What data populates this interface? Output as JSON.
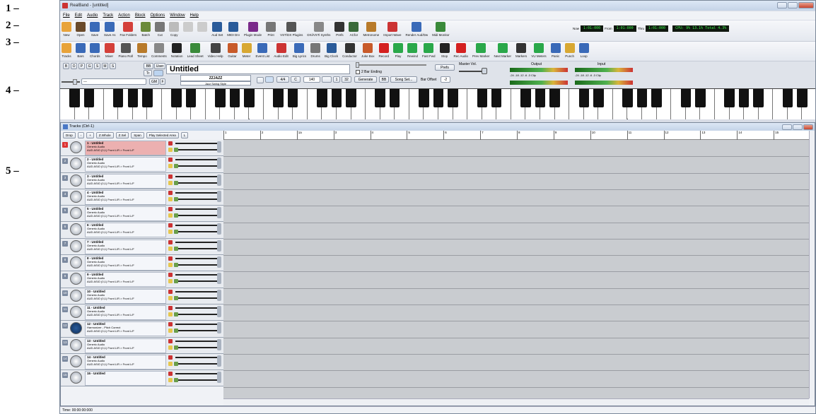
{
  "callouts": [
    "1 –",
    "2 –",
    "3 –",
    "4 –",
    "5 –"
  ],
  "window": {
    "title": "RealBand - [untitled]"
  },
  "menu": [
    "File",
    "Edit",
    "Audio",
    "Track",
    "Action",
    "Block",
    "Options",
    "Window",
    "Help"
  ],
  "toolbar1": {
    "buttons": [
      {
        "label": "New",
        "icon": "new-file-icon",
        "color": "#e8a33a"
      },
      {
        "label": "Open",
        "icon": "open-folder-icon",
        "color": "#6a4a2a"
      },
      {
        "label": "Save",
        "icon": "save-icon",
        "color": "#3a6ab8"
      },
      {
        "label": "Save As",
        "icon": "save-as-icon",
        "color": "#3a6ab8"
      },
      {
        "label": "Fav Folders",
        "icon": "fav-folders-icon",
        "color": "#d4403a"
      },
      {
        "label": "Batch",
        "icon": "batch-icon",
        "color": "#6a8a3a"
      },
      {
        "label": "Cut",
        "icon": "scissors-icon",
        "color": "#777"
      },
      {
        "label": "Copy",
        "icon": "copy-icon",
        "color": "#bbb"
      },
      {
        "label": "",
        "icon": "paste-icon",
        "color": "#ccc"
      },
      {
        "label": "",
        "icon": "undo-icon",
        "color": "#ccc"
      },
      {
        "label": "Aud Set",
        "icon": "audio-settings-icon",
        "color": "#2a5b9a"
      },
      {
        "label": "MIDI Drv",
        "icon": "midi-driver-icon",
        "color": "#2a5b9a"
      },
      {
        "label": "Plugin Mode",
        "icon": "plugin-mode-icon",
        "color": "#7a2a8a"
      },
      {
        "label": "Print",
        "icon": "print-icon",
        "color": "#777"
      },
      {
        "label": "VST/DX Plugins",
        "icon": "plugins-icon",
        "color": "#555"
      },
      {
        "label": "DXi/VSTi Synths",
        "icon": "synths-icon",
        "color": "#888"
      },
      {
        "label": "Prefs",
        "icon": "prefs-icon",
        "color": "#333"
      },
      {
        "label": "ACfor",
        "icon": "acfor-icon",
        "color": "#3a6a3a"
      },
      {
        "label": "Metronome",
        "icon": "metronome-icon",
        "color": "#b87a2a"
      },
      {
        "label": "Import Wave",
        "icon": "import-wave-icon",
        "color": "#c33"
      },
      {
        "label": "Render Aud/Dw",
        "icon": "render-audio-icon",
        "color": "#3a6ab8"
      },
      {
        "label": "Midi Monitor",
        "icon": "midi-monitor-icon",
        "color": "#3a8a3a"
      }
    ],
    "now_label": "Now",
    "now_value": "1:01:000",
    "from_label": "From",
    "from_value": "1:01:000",
    "thru_label": "Thru",
    "thru_value": "1:01:000",
    "cpu": "CPU: 9% 13.1% Total 4.3%"
  },
  "toolbar2": {
    "buttons": [
      {
        "label": "Tracks",
        "icon": "tracks-icon",
        "color": "#e8a33a"
      },
      {
        "label": "Bars",
        "icon": "bars-icon",
        "color": "#3a6ab8"
      },
      {
        "label": "Chords",
        "icon": "chords-icon",
        "color": "#3a6ab8"
      },
      {
        "label": "Mixer",
        "icon": "mixer-icon",
        "color": "#d4403a"
      },
      {
        "label": "Piano Roll",
        "icon": "piano-roll-icon",
        "color": "#555"
      },
      {
        "label": "Tempo",
        "icon": "tempo-icon",
        "color": "#b87a2a"
      },
      {
        "label": "Comments",
        "icon": "comments-icon",
        "color": "#888"
      },
      {
        "label": "Notation",
        "icon": "notation-icon",
        "color": "#222"
      },
      {
        "label": "Lead Sheet",
        "icon": "lead-sheet-icon",
        "color": "#3a8a3a"
      },
      {
        "label": "Video Help",
        "icon": "video-help-icon",
        "color": "#444"
      },
      {
        "label": "Guitar",
        "icon": "guitar-icon",
        "color": "#c85a2a"
      },
      {
        "label": "Meter",
        "icon": "meter-icon",
        "color": "#d8a832"
      },
      {
        "label": "Event List",
        "icon": "event-list-icon",
        "color": "#3a6ab8"
      },
      {
        "label": "Audio Edit",
        "icon": "audio-edit-icon",
        "color": "#c33"
      },
      {
        "label": "Big Lyrics",
        "icon": "big-lyrics-icon",
        "color": "#3a6ab8"
      },
      {
        "label": "Drums",
        "icon": "drums-icon",
        "color": "#777"
      },
      {
        "label": "Big Clock",
        "icon": "big-clock-icon",
        "color": "#2a5b9a"
      },
      {
        "label": "Conductor",
        "icon": "conductor-icon",
        "color": "#333"
      },
      {
        "label": "Juke Box",
        "icon": "juke-box-icon",
        "color": "#c85a2a"
      },
      {
        "label": "Record",
        "icon": "record-icon",
        "color": "#d42020"
      },
      {
        "label": "Play",
        "icon": "play-icon",
        "color": "#2aa84a"
      },
      {
        "label": "Rewind",
        "icon": "rewind-icon",
        "color": "#2aa84a"
      },
      {
        "label": "Fast Fwd",
        "icon": "fast-forward-icon",
        "color": "#2aa84a"
      },
      {
        "label": "Stop",
        "icon": "stop-icon",
        "color": "#222"
      },
      {
        "label": "Rec Audio",
        "icon": "rec-audio-icon",
        "color": "#d42020"
      },
      {
        "label": "Prev Marker",
        "icon": "prev-marker-icon",
        "color": "#2aa84a"
      },
      {
        "label": "Next Marker",
        "icon": "next-marker-icon",
        "color": "#2aa84a"
      },
      {
        "label": "Markers",
        "icon": "markers-icon",
        "color": "#333"
      },
      {
        "label": "VU Meters",
        "icon": "vu-meters-icon",
        "color": "#2aa84a"
      },
      {
        "label": "Panic",
        "icon": "panic-icon",
        "color": "#3a6ab8"
      },
      {
        "label": "Punch",
        "icon": "punch-icon",
        "color": "#d8a832"
      },
      {
        "label": "Loop",
        "icon": "loop-icon",
        "color": "#3a6ab8"
      }
    ]
  },
  "controls": {
    "mode_buttons": [
      "B",
      "O",
      "P",
      "G",
      "S",
      "M",
      "S"
    ],
    "bb_label": "BB",
    "user_label": "User",
    "tr_label": "Tr",
    "gm_label": "GM",
    "f_label": "F",
    "instrument_value": "---",
    "song_title": "Untitled",
    "style_code": "ZZJAZZ",
    "style_name": "Jazz Swing Style",
    "time_sig": "4/4",
    "key": "C",
    "tempo": "140",
    "start_bar": "1",
    "end_bar": "32",
    "generate_label": "Generate",
    "bb2_label": "BB",
    "song_set_label": "Song Set...",
    "bar_offset_label": "Bar Offset",
    "bar_offset_value": "-2",
    "two_bar_ending_label": "2 Bar Ending",
    "prefs_label": "Prefs",
    "master_vol_label": "Master Vol.",
    "output_label": "Output",
    "input_label": "Input",
    "meter_scale": "-24  -18  -12   -6  -3  Clip"
  },
  "tracks_window": {
    "title": "Tracks (Ctrl-1)",
    "toolbar": [
      "Drop",
      "-",
      "+",
      "Z.Whole",
      "Z.Sel",
      "Span",
      "Play Selected Area",
      "L"
    ],
    "ruler": [
      "1",
      "2",
      "1a",
      "3",
      "4",
      "5",
      "6",
      "7",
      "8",
      "9",
      "10",
      "11",
      "12",
      "13",
      "14",
      "15"
    ],
    "tracks": [
      {
        "num": "1",
        "name": "1 - Untitled",
        "type": "Generic Audio",
        "route": "AUD ASIO (0,1) Front L/R > Front L/F",
        "selected": true,
        "hp": false
      },
      {
        "num": "2",
        "name": "2 - Untitled",
        "type": "Generic Audio",
        "route": "AUD ASIO (0,1) Front L/R > Front L/F",
        "selected": false,
        "hp": false
      },
      {
        "num": "3",
        "name": "3 - Untitled",
        "type": "Generic Audio",
        "route": "AUD ASIO (0,1) Front L/R > Front L/F",
        "selected": false,
        "hp": false
      },
      {
        "num": "4",
        "name": "4 - Untitled",
        "type": "Generic Audio",
        "route": "AUD ASIO (0,1) Front L/R > Front L/F",
        "selected": false,
        "hp": false
      },
      {
        "num": "5",
        "name": "5 - Untitled",
        "type": "Generic Audio",
        "route": "AUD ASIO (0,1) Front L/R > Front L/F",
        "selected": false,
        "hp": false
      },
      {
        "num": "6",
        "name": "6 - Untitled",
        "type": "Generic Audio",
        "route": "AUD ASIO (0,1) Front L/R > Front L/F",
        "selected": false,
        "hp": false
      },
      {
        "num": "7",
        "name": "7 - Untitled",
        "type": "Generic Audio",
        "route": "AUD ASIO (0,1) Front L/R > Front L/F",
        "selected": false,
        "hp": false
      },
      {
        "num": "8",
        "name": "8 - Untitled",
        "type": "Generic Audio",
        "route": "AUD ASIO (0,1) Front L/R > Front L/F",
        "selected": false,
        "hp": false
      },
      {
        "num": "9",
        "name": "9 - Untitled",
        "type": "Generic Audio",
        "route": "AUD ASIO (0,1) Front L/R > Front L/F",
        "selected": false,
        "hp": false
      },
      {
        "num": "10",
        "name": "10 - Untitled",
        "type": "Generic Audio",
        "route": "AUD ASIO (0,1) Front L/R > Front L/F",
        "selected": false,
        "hp": false
      },
      {
        "num": "11",
        "name": "11 - Untitled",
        "type": "Generic Audio",
        "route": "AUD ASIO (0,1) Front L/R > Front L/F",
        "selected": false,
        "hp": false
      },
      {
        "num": "12",
        "name": "12 - Untitled",
        "type": "Harmonizer - Pitch Correct",
        "route": "AUD ASIO (0,1) Front L/R > Front L/F",
        "selected": false,
        "hp": true
      },
      {
        "num": "13",
        "name": "13 - Untitled",
        "type": "Generic Audio",
        "route": "AUD ASIO (0,1) Front L/R > Front L/F",
        "selected": false,
        "hp": false
      },
      {
        "num": "14",
        "name": "14 - Untitled",
        "type": "Generic Audio",
        "route": "AUD ASIO (0,1) Front L/R > Front L/F",
        "selected": false,
        "hp": false
      },
      {
        "num": "15",
        "name": "15 - Untitled",
        "type": "",
        "route": "",
        "selected": false,
        "hp": false
      }
    ]
  },
  "status": "Time: 00:00:00:000"
}
